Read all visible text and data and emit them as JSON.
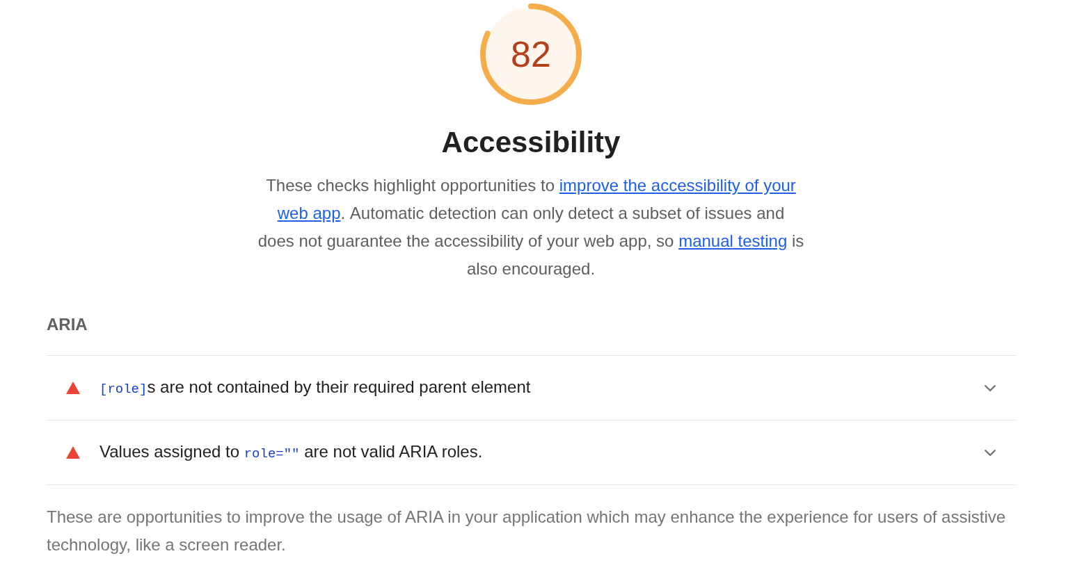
{
  "category": {
    "gauge": {
      "score": "82",
      "level": 0.82
    },
    "title": "Accessibility",
    "description": [
      {
        "kind": "text",
        "text": "These checks highlight opportunities to "
      },
      {
        "kind": "link",
        "text": "improve the accessibility of your "
      },
      {
        "kind": "link",
        "text": "web app"
      },
      {
        "kind": "text",
        "text": ". Automatic detection can only detect a subset of issues and does not guarantee the accessibility of your web app, so "
      },
      {
        "kind": "link",
        "text": "manual testing"
      },
      {
        "kind": "text",
        "text": " is also encouraged."
      }
    ]
  },
  "groups": [
    {
      "title": "ARIA",
      "audits": [
        {
          "passed": false,
          "expanded": false,
          "title": [
            {
              "kind": "code",
              "text": "[role]"
            },
            {
              "kind": "text",
              "text": "s are not contained by their required parent element"
            }
          ]
        },
        {
          "passed": false,
          "expanded": false,
          "title": [
            {
              "kind": "text",
              "text": "Values assigned to "
            },
            {
              "kind": "code",
              "text": "role=\"\""
            },
            {
              "kind": "text",
              "text": " are not valid ARIA roles."
            }
          ]
        }
      ],
      "description": "These are opportunities to improve the usage of ARIA in your application which may enhance the experience for users of assistive technology, like a screen reader."
    }
  ]
}
